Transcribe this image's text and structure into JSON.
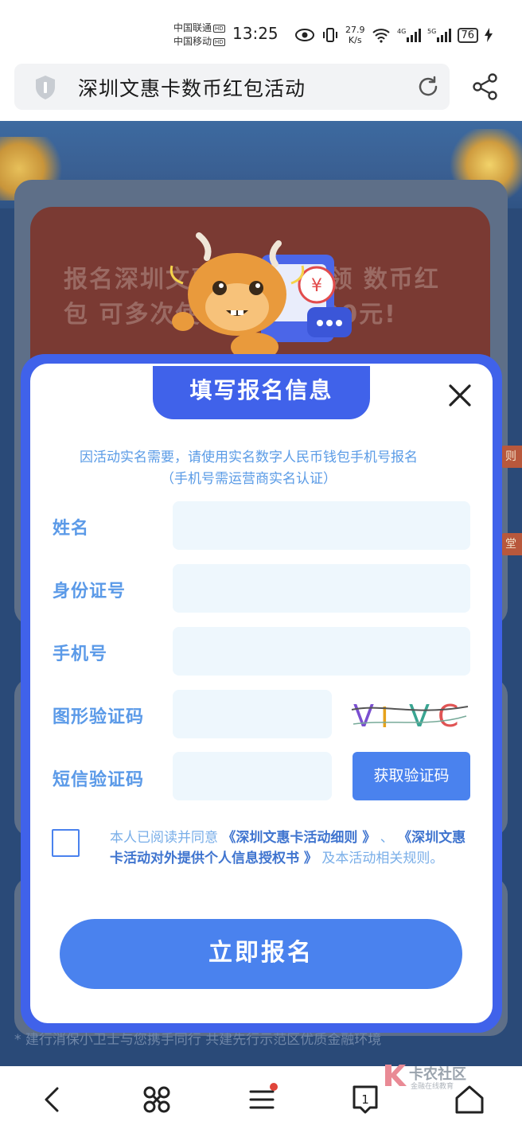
{
  "status_bar": {
    "carrier_1": "中国联通",
    "carrier_2": "中国移动",
    "hd_badge": "HD",
    "time": "13:25",
    "net_speed_value": "27.9",
    "net_speed_unit": "K/s",
    "signal_label_1": "4G",
    "signal_label_2": "5G",
    "battery": "76"
  },
  "browser": {
    "page_title": "深圳文惠卡数币红包活动",
    "icons": [
      "shield-icon",
      "reload-icon",
      "share-icon"
    ]
  },
  "background": {
    "promo_text": "报名深圳文惠卡 有机会领 数币红包 可多次使 用，累计 00元!",
    "side_chip_1": "则",
    "side_chip_2": "堂",
    "footer_note": "* 建行消保小卫士与您携手同行 共建先行示范区优质金融环境"
  },
  "modal": {
    "title": "填写报名信息",
    "notice_line_1": "因活动实名需要，请使用实名数字人民币钱包手机号报名",
    "notice_line_2": "（手机号需运营商实名认证）",
    "fields": {
      "name_label": "姓名",
      "name_value": "",
      "id_label": "身份证号",
      "id_value": "",
      "phone_label": "手机号",
      "phone_value": "",
      "captcha_label": "图形验证码",
      "captcha_value": "",
      "captcha_image_text": "VIVC",
      "sms_label": "短信验证码",
      "sms_value": ""
    },
    "sms_button": "获取验证码",
    "agreement": {
      "checked": false,
      "prefix": "本人已阅读并同意",
      "link_1": "《深圳文惠卡活动细则 》",
      "separator": "、",
      "link_2": "《深圳文惠卡活动对外提供个人信息授权书 》",
      "suffix": "及本活动相关规则。"
    },
    "submit_button": "立即报名"
  },
  "bottom_nav": {
    "items": [
      "back-icon",
      "command-icon",
      "menu-icon",
      "tabs-icon",
      "home-icon"
    ],
    "tab_count": "1",
    "menu_has_dot": true
  },
  "watermark": {
    "text": "卡农社区",
    "sub": "金融在线教育"
  },
  "colors": {
    "modal_blue": "#4062ea",
    "button_blue": "#4a82ee",
    "label_blue": "#5b9ae8",
    "input_bg": "#eef7fd",
    "page_bg": "#2a4a78"
  }
}
